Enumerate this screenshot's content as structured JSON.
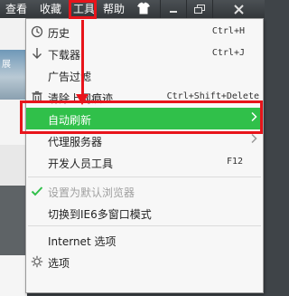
{
  "menubar": {
    "items": [
      "查看",
      "收藏",
      "工具",
      "帮助"
    ],
    "skin_icon": "shirt-icon",
    "window_buttons": [
      "minimize-icon",
      "restore-icon",
      "close-icon"
    ]
  },
  "menu": {
    "items": [
      {
        "label": "历史",
        "shortcut": "Ctrl+H",
        "icon": "clock-icon"
      },
      {
        "label": "下载器",
        "shortcut": "Ctrl+J",
        "icon": "download-icon"
      },
      {
        "label": "广告过滤",
        "icon": "filter-icon"
      },
      {
        "label": "清除上网痕迹",
        "shortcut": "Ctrl+Shift+Delete",
        "icon": "trash-icon"
      },
      {
        "label": "自动刷新",
        "submenu": true
      },
      {
        "label": "代理服务器",
        "submenu": true
      },
      {
        "label": "开发人员工具",
        "shortcut": "F12"
      },
      {
        "label": "设置为默认浏览器",
        "disabled": true,
        "icon": "checkmark-icon"
      },
      {
        "label": "切换到IE6多窗口模式"
      },
      {
        "label": "Internet 选项"
      },
      {
        "label": "选项",
        "icon": "gear-icon"
      }
    ]
  },
  "background": {
    "snippet": "展"
  },
  "colors": {
    "highlight": "#30c04a",
    "annotation": "#e8141b",
    "menubar": "#3f4448"
  }
}
